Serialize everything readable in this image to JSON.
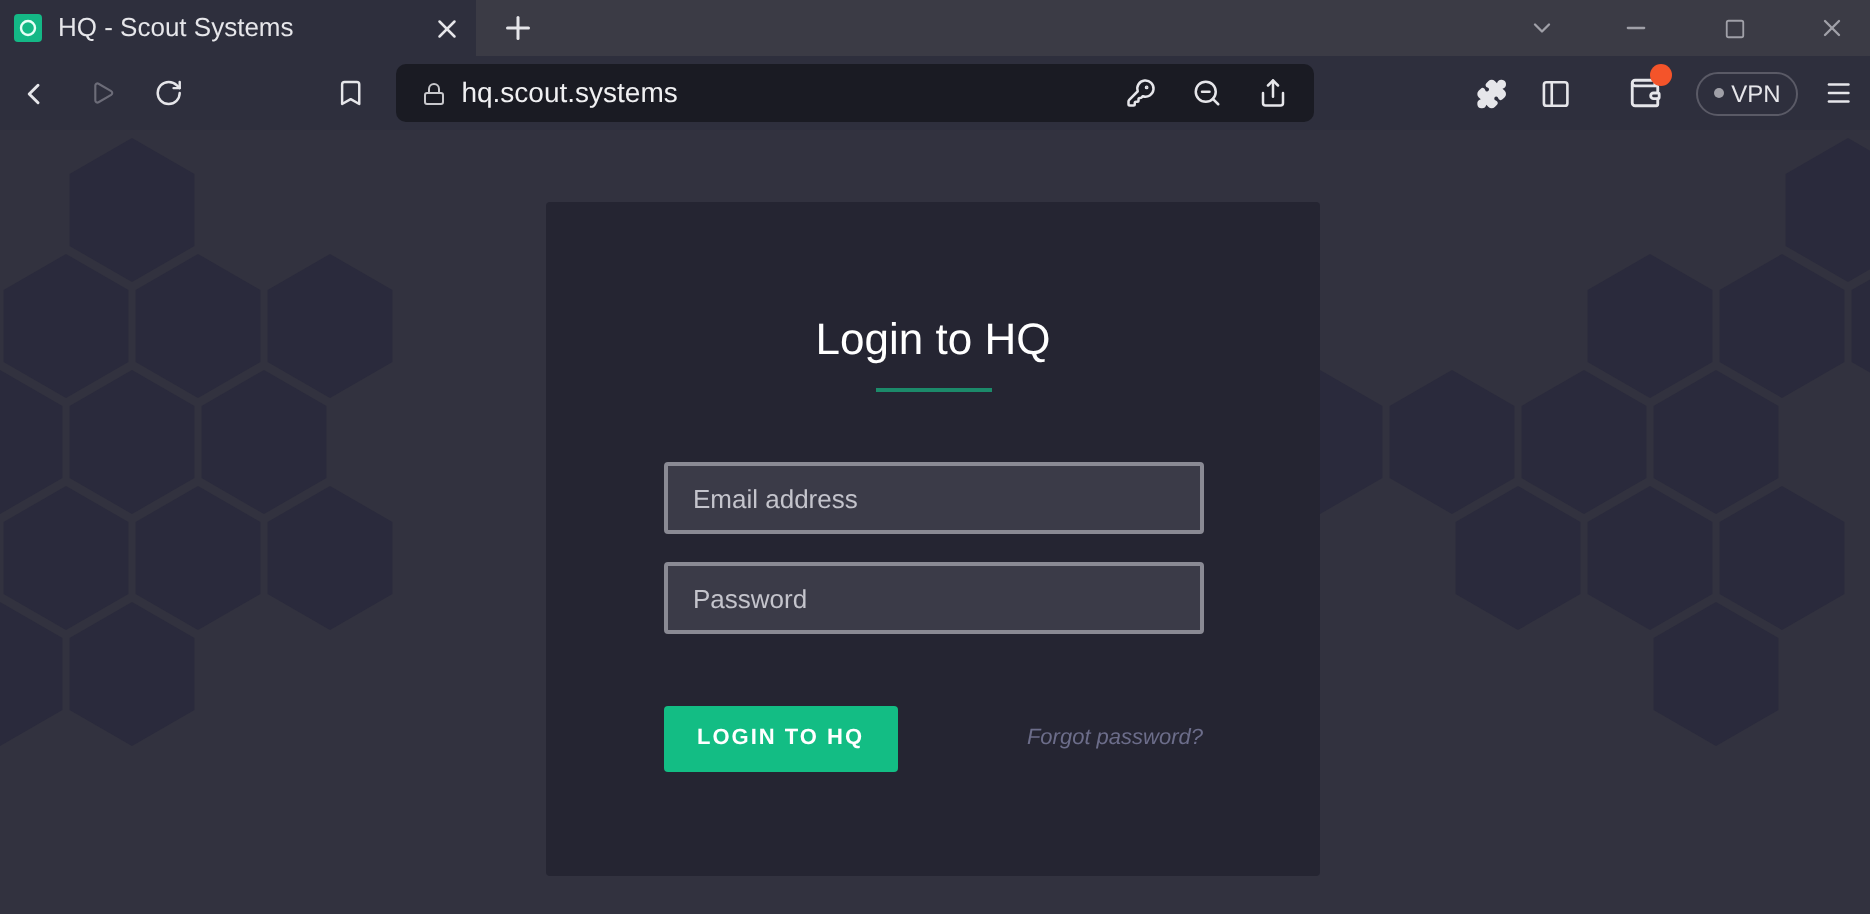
{
  "browser": {
    "tab": {
      "title": "HQ - Scout Systems",
      "selected": true
    },
    "address": "hq.scout.systems",
    "vpn": {
      "label": "VPN",
      "on": false
    },
    "wallet_notification": true
  },
  "login": {
    "title": "Login to HQ",
    "fields": [
      {
        "placeholder": "Email address"
      },
      {
        "placeholder": "Password"
      }
    ],
    "submit": "LOGIN TO HQ",
    "forgot": "Forgot password?"
  }
}
